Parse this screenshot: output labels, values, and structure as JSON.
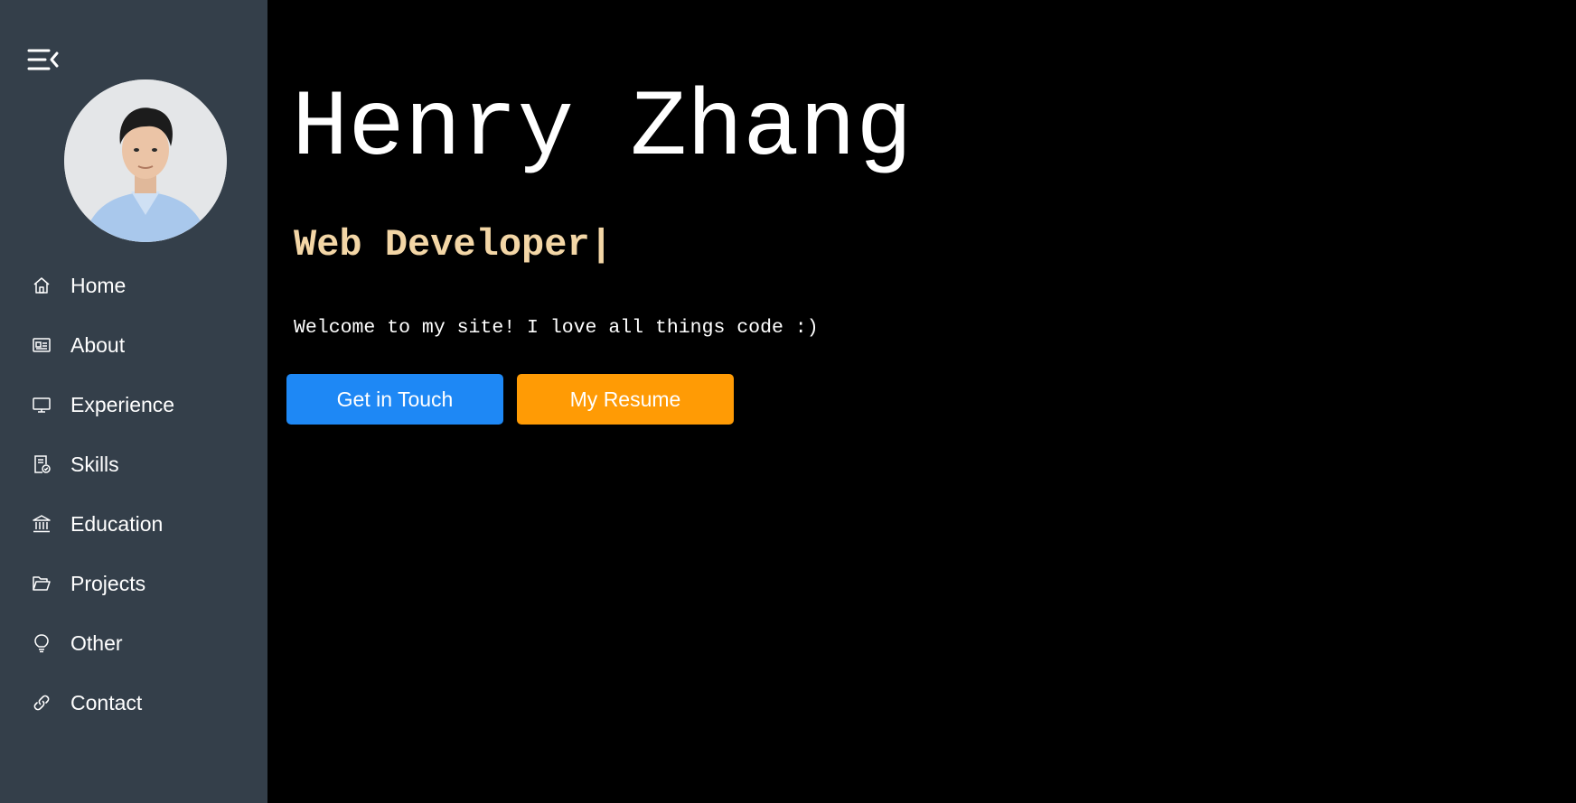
{
  "sidebar": {
    "toggle_icon": "menu-collapse-icon",
    "avatar_alt": "profile photo",
    "items": [
      {
        "label": "Home",
        "icon": "home-icon"
      },
      {
        "label": "About",
        "icon": "id-card-icon"
      },
      {
        "label": "Experience",
        "icon": "monitor-icon"
      },
      {
        "label": "Skills",
        "icon": "certificate-icon"
      },
      {
        "label": "Education",
        "icon": "bank-icon"
      },
      {
        "label": "Projects",
        "icon": "folder-open-icon"
      },
      {
        "label": "Other",
        "icon": "lightbulb-icon"
      },
      {
        "label": "Contact",
        "icon": "link-icon"
      }
    ]
  },
  "hero": {
    "name": "Henry Zhang",
    "role": "Web Developer",
    "cursor": "|",
    "welcome": "Welcome to my site! I love all things code :)",
    "primary_button": "Get in Touch",
    "secondary_button": "My Resume"
  },
  "colors": {
    "sidebar_bg": "#343f4a",
    "main_bg": "#000000",
    "role_text": "#f3d6a6",
    "primary_button": "#1e88f5",
    "secondary_button": "#ff9b05"
  }
}
